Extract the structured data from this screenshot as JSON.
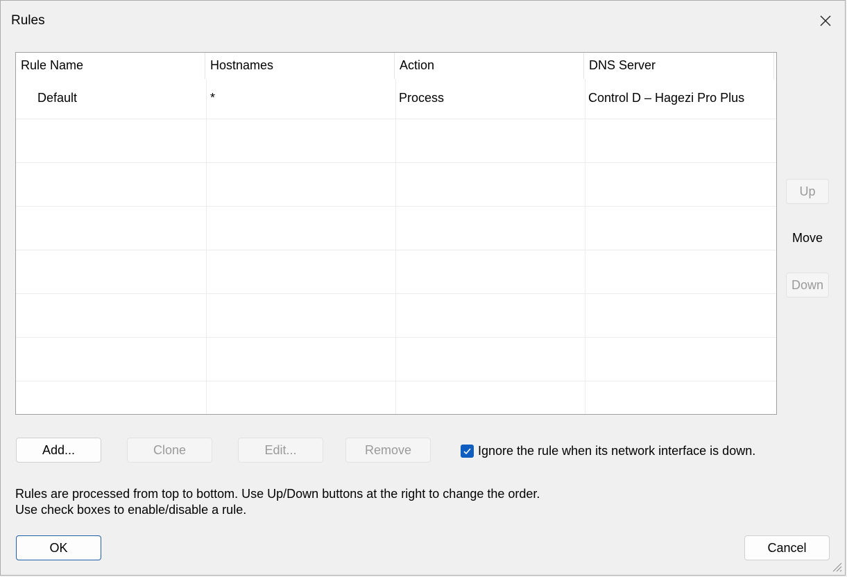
{
  "window": {
    "title": "Rules",
    "close_icon": "close-icon"
  },
  "table": {
    "columns": [
      "Rule Name",
      "Hostnames",
      "Action",
      "DNS Server"
    ],
    "rows": [
      {
        "rule_name": "Default",
        "hostnames": "*",
        "action": "Process",
        "dns_server": "Control D – Hagezi Pro Plus"
      }
    ]
  },
  "side_buttons": {
    "up_label": "Up",
    "move_label": "Move",
    "down_label": "Down"
  },
  "action_buttons": {
    "add_label": "Add...",
    "clone_label": "Clone",
    "edit_label": "Edit...",
    "remove_label": "Remove"
  },
  "ignore_checkbox": {
    "checked": true,
    "label": "Ignore the rule when its network interface is down."
  },
  "info_text": {
    "line1": "Rules are processed from top to bottom. Use Up/Down buttons at the right to change the order.",
    "line2": "Use check boxes to enable/disable a rule."
  },
  "footer": {
    "ok_label": "OK",
    "cancel_label": "Cancel"
  },
  "colors": {
    "accent": "#0f5dbf",
    "window_bg": "#f0f0f0",
    "disabled_text": "#9a9a9a"
  }
}
